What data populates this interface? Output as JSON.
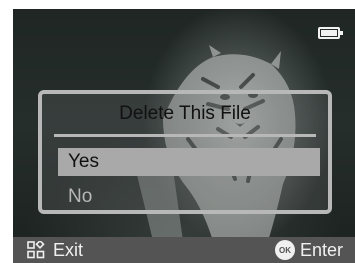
{
  "status_bar": {
    "battery_icon": "battery-full-icon"
  },
  "dialog": {
    "title": "Delete This File",
    "options": [
      {
        "label": "Yes",
        "selected": true
      },
      {
        "label": "No",
        "selected": false
      }
    ]
  },
  "bottom_bar": {
    "exit_icon": "menu-grid-icon",
    "exit_label": "Exit",
    "ok_icon_text": "OK",
    "enter_label": "Enter"
  },
  "colors": {
    "selection": "#a9a9a9",
    "dialog_border": "#b8b8b8",
    "bottom_bar": "#545454"
  }
}
